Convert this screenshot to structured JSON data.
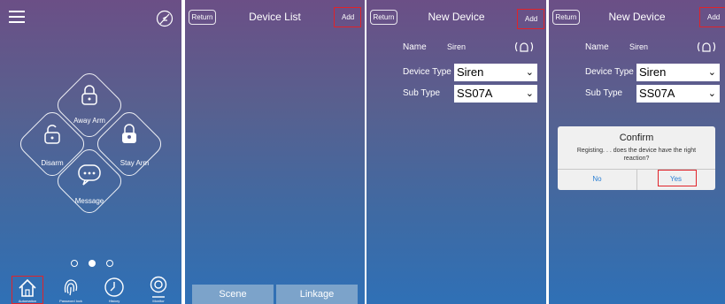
{
  "home": {
    "menu_icon": "hamburger-icon",
    "logo_icon": "feather-icon",
    "buttons": {
      "away": "Away Arm",
      "disarm": "Disarm",
      "stay": "Stay Arm",
      "message": "Message"
    },
    "page_dots": 3,
    "active_dot": 1,
    "nav": [
      "Automation",
      "Password lock",
      "History",
      "Monitor"
    ]
  },
  "device_list": {
    "return_label": "Return",
    "title": "Device  List",
    "add_label": "Add",
    "tabs": [
      "Scene",
      "Linkage"
    ]
  },
  "new_device": {
    "return_label": "Return",
    "title": "New Device",
    "add_label": "Add",
    "name_label": "Name",
    "name_value": "Siren",
    "device_type_label": "Device Type",
    "device_type_value": "Siren",
    "sub_type_label": "Sub Type",
    "sub_type_value": "SS07A"
  },
  "confirm": {
    "title": "Confirm",
    "message": "Registing. . . does the device have the right reaction?",
    "no_label": "No",
    "yes_label": "Yes"
  },
  "colors": {
    "highlight": "#e0232a",
    "link_blue": "#2a7fd4"
  }
}
